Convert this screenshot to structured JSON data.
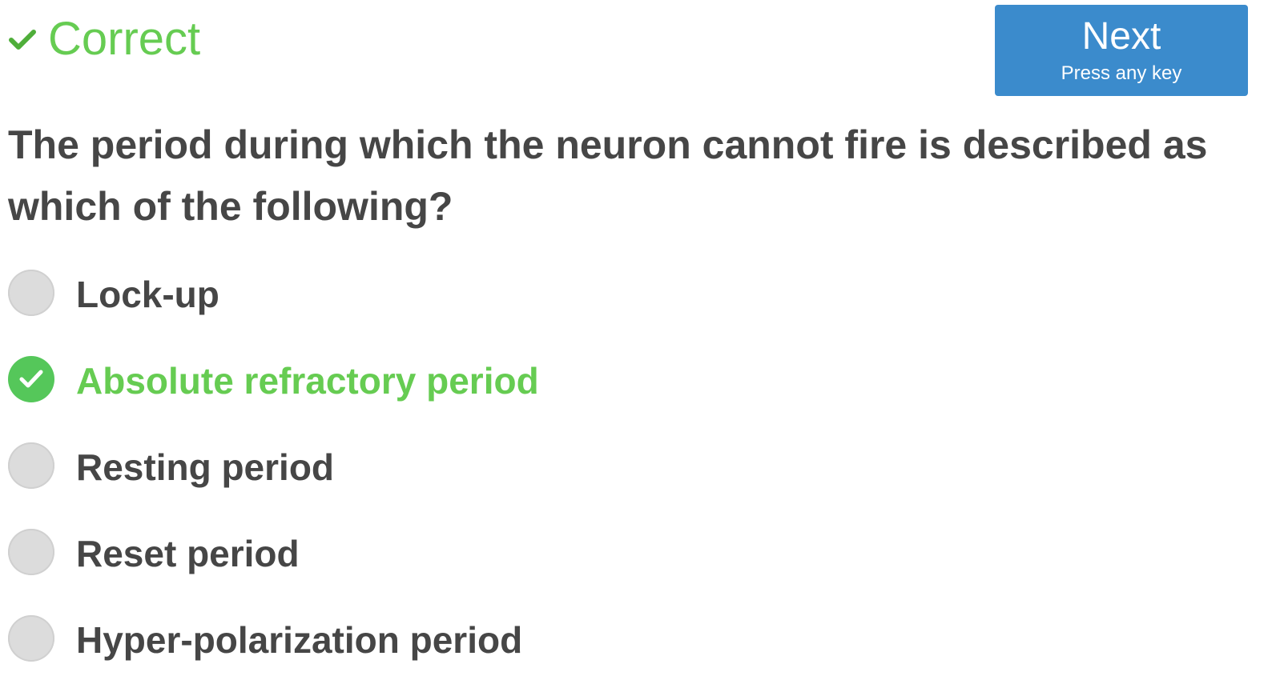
{
  "feedback": {
    "status_text": "Correct",
    "status_icon": "check-icon",
    "status_color": "#66cc52"
  },
  "next_button": {
    "label": "Next",
    "hint": "Press any key",
    "color": "#3b8bcc"
  },
  "question": {
    "text": "The period during which the neuron cannot fire is described as which of the following?"
  },
  "options": [
    {
      "label": "Lock-up",
      "state": "unselected"
    },
    {
      "label": "Absolute refractory period",
      "state": "correct-selected"
    },
    {
      "label": "Resting period",
      "state": "unselected"
    },
    {
      "label": "Reset period",
      "state": "unselected"
    },
    {
      "label": "Hyper-polarization period",
      "state": "unselected"
    }
  ]
}
